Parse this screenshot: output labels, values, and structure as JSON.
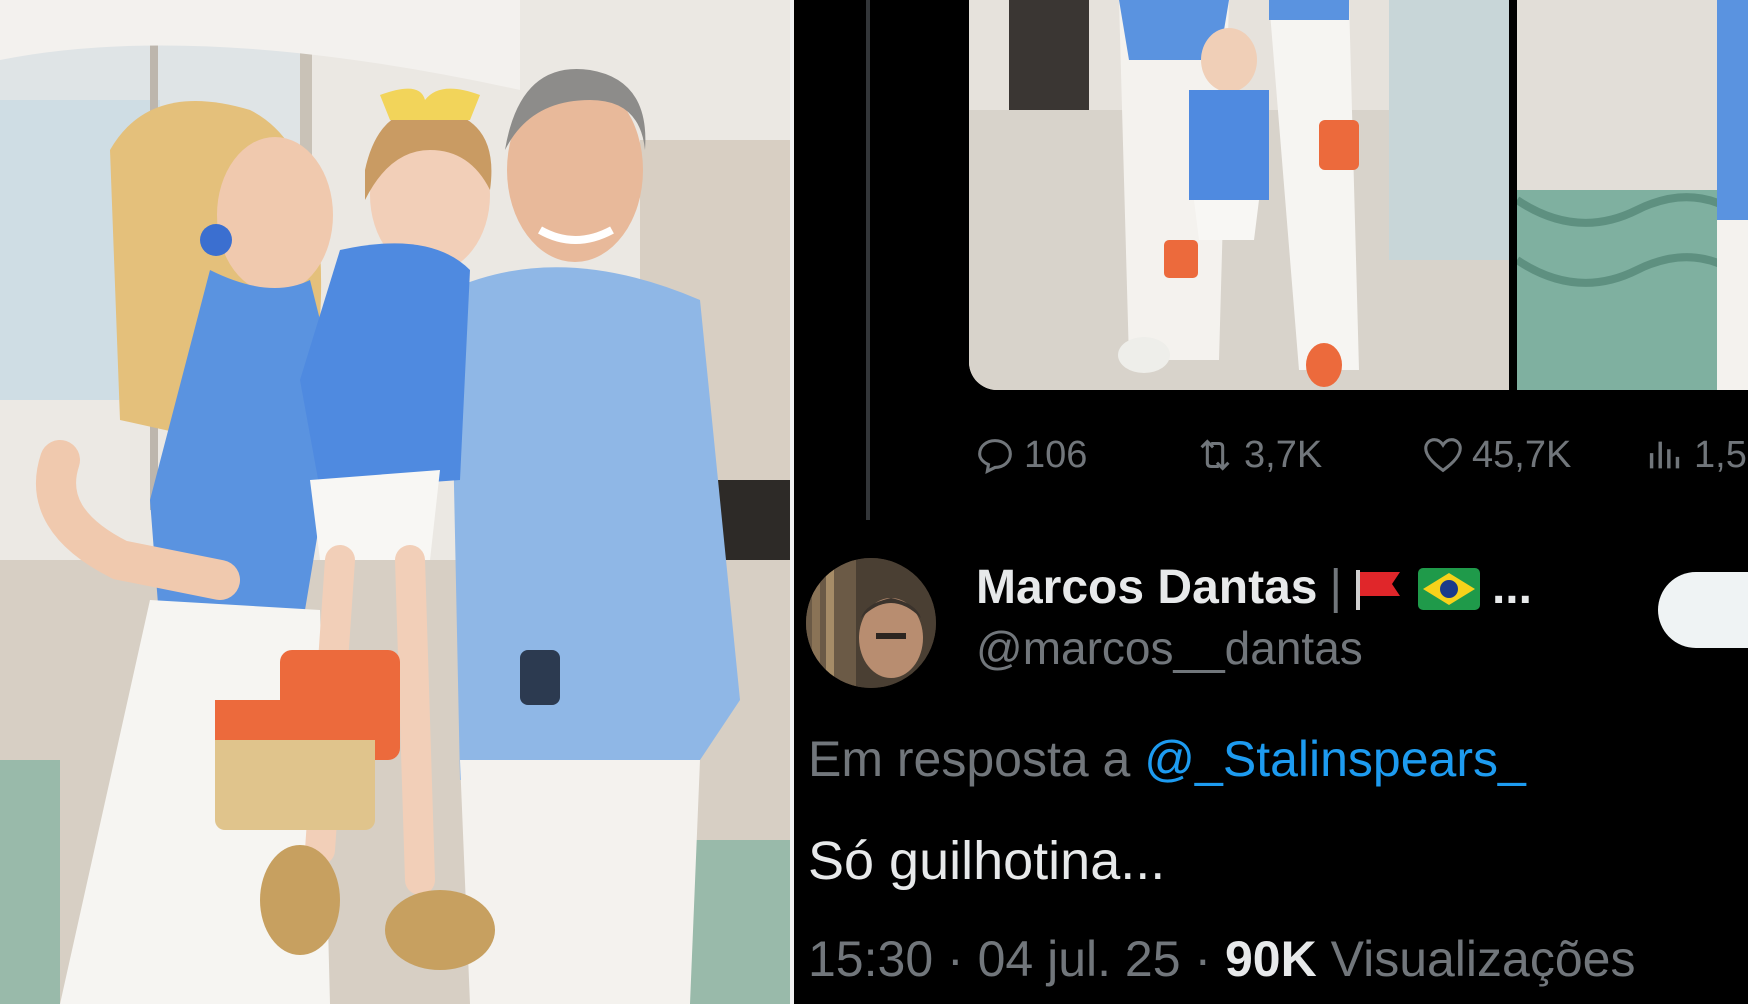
{
  "tweet": {
    "stats": {
      "replies": "106",
      "retweets": "3,7K",
      "likes": "45,7K",
      "views": "1,5"
    },
    "author": {
      "name": "Marcos Dantas",
      "name_suffix": "...",
      "handle": "@marcos__dantas"
    },
    "reply_prefix": "Em resposta a",
    "reply_to_handle": "@_Stalinspears_",
    "text": "Só guilhotina...",
    "time": "15:30",
    "dot": "·",
    "date": "04 jul. 25",
    "views_count": "90K",
    "views_label": "Visualizações"
  },
  "colors": {
    "background": "#000000",
    "text_primary": "#e7e9ea",
    "text_secondary": "#71767b",
    "link": "#1d9bf0",
    "shirt_blue": "#5a93e0",
    "bag_orange": "#ec6a3c"
  },
  "icons": {
    "reply": "speech-bubble-icon",
    "retweet": "retweet-icon",
    "like": "heart-icon",
    "views": "bar-chart-icon"
  }
}
